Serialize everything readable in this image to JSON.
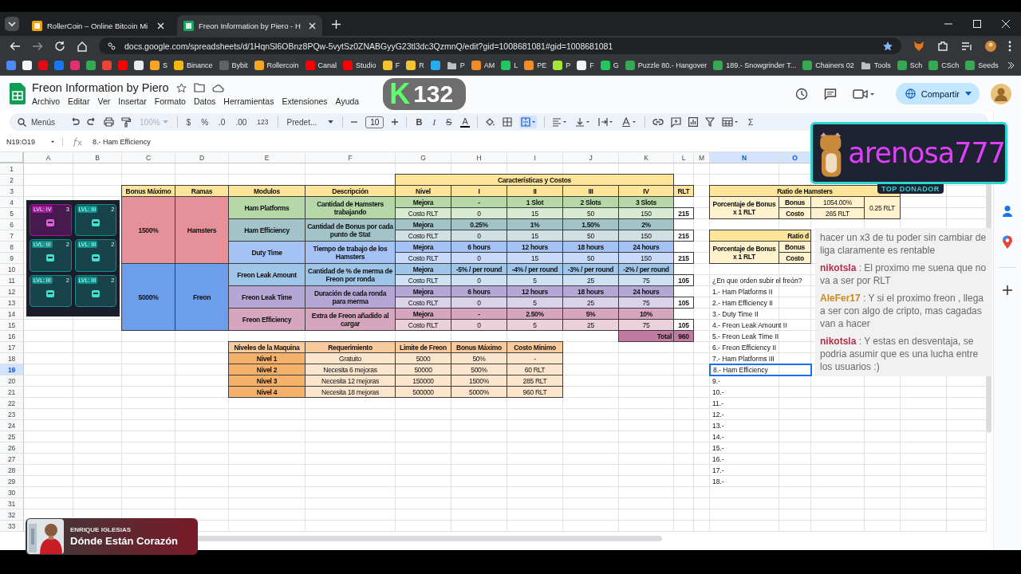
{
  "browser": {
    "tabs": [
      {
        "title": "RollerCoin – Online Bitcoin Mi",
        "selected": false
      },
      {
        "title": "Freon Information by Piero - H",
        "selected": true
      }
    ],
    "url": "docs.google.com/spreadsheets/d/1HqnSl6OBnz8PQw-5vytSz0ZNABGyyG23tl3dc3QzmnQ/edit?gid=1008681081#gid=1008681081",
    "bookmarks": [
      {
        "kind": "site",
        "color": "#4c8bf5"
      },
      {
        "kind": "site",
        "color": "#f1f3f4"
      },
      {
        "kind": "site",
        "color": "#e50914"
      },
      {
        "kind": "site",
        "color": "#1877f2"
      },
      {
        "kind": "site",
        "color": "#e1306c"
      },
      {
        "kind": "site",
        "color": "#34a853"
      },
      {
        "kind": "site",
        "color": "#ea4335"
      },
      {
        "kind": "site",
        "color": "#ff0000"
      },
      {
        "kind": "site",
        "color": "#e8eaed"
      },
      {
        "kind": "site",
        "color": "#f5a623",
        "label": "S"
      },
      {
        "kind": "site",
        "color": "#f0b90b",
        "label": "Binance"
      },
      {
        "kind": "site",
        "color": "#5f6368",
        "label": "Bybit"
      },
      {
        "kind": "site",
        "color": "#f5a623",
        "label": "Rollercoin"
      },
      {
        "kind": "site",
        "color": "#ff0000",
        "label": "Canal"
      },
      {
        "kind": "site",
        "color": "#ff0000",
        "label": "Studio"
      },
      {
        "kind": "site",
        "color": "#f4c430",
        "label": "F"
      },
      {
        "kind": "site",
        "color": "#f4c430",
        "label": "R"
      },
      {
        "kind": "site",
        "color": "#2aabee"
      },
      {
        "kind": "folder",
        "color": "#bdc1c6",
        "label": "P"
      },
      {
        "kind": "site",
        "color": "#f28c28",
        "label": "AM"
      },
      {
        "kind": "site",
        "color": "#22c55e",
        "label": "L"
      },
      {
        "kind": "site",
        "color": "#f28c28",
        "label": "PE"
      },
      {
        "kind": "site",
        "color": "#a3e635",
        "label": "P"
      },
      {
        "kind": "site",
        "color": "#f1f3f4",
        "label": "F"
      },
      {
        "kind": "site",
        "color": "#22c55e",
        "label": "G"
      },
      {
        "kind": "site",
        "color": "#34a853",
        "label": "Puzzle 80.- Hangover"
      },
      {
        "kind": "site",
        "color": "#34a853",
        "label": "189.- Snowgrinder T..."
      },
      {
        "kind": "site",
        "color": "#34a853",
        "label": "Chainers 02"
      },
      {
        "kind": "folder",
        "color": "#bdc1c6",
        "label": "Tools"
      },
      {
        "kind": "site",
        "color": "#34a853",
        "label": "Sch"
      },
      {
        "kind": "site",
        "color": "#34a853",
        "label": "CSch"
      },
      {
        "kind": "site",
        "color": "#34a853",
        "label": "Seeds"
      }
    ]
  },
  "document": {
    "title": "Freon Information by Piero",
    "menu": [
      "Archivo",
      "Editar",
      "Ver",
      "Insertar",
      "Formato",
      "Datos",
      "Herramientas",
      "Extensiones",
      "Ayuda"
    ],
    "share_button": "Compartir"
  },
  "toolbar": {
    "search": "Menús",
    "zoom": {
      "label": "100%",
      "disabled": true
    },
    "currency": "$",
    "percent": "%",
    "decrease_decimals": ".0",
    "increase_decimals": ".00",
    "number_format": "123",
    "font": "Predet...",
    "font_size": "10",
    "bold": "B",
    "italic": "I",
    "strikethrough": "S",
    "text_color": "A",
    "sum": "Σ"
  },
  "formula_bar": {
    "cell": "N19:O19",
    "value": "8.- Ham Efficiency"
  },
  "sheet": {
    "columns": [
      {
        "label": "A",
        "selected": false
      },
      {
        "label": "B",
        "selected": false
      },
      {
        "label": "C",
        "selected": false
      },
      {
        "label": "D",
        "selected": false
      },
      {
        "label": "E",
        "selected": false
      },
      {
        "label": "F",
        "selected": false
      },
      {
        "label": "G",
        "selected": false
      },
      {
        "label": "H",
        "selected": false
      },
      {
        "label": "I",
        "selected": false
      },
      {
        "label": "J",
        "selected": false
      },
      {
        "label": "K",
        "selected": false
      },
      {
        "label": "L",
        "selected": false
      },
      {
        "label": "M",
        "selected": false
      },
      {
        "label": "N",
        "selected": true
      },
      {
        "label": "O",
        "selected": true
      }
    ],
    "rows": [
      {
        "label": "1",
        "selected": false
      },
      {
        "label": "2",
        "selected": false
      },
      {
        "label": "3",
        "selected": false
      },
      {
        "label": "4",
        "selected": false
      },
      {
        "label": "5",
        "selected": false
      },
      {
        "label": "6",
        "selected": false
      },
      {
        "label": "7",
        "selected": false
      },
      {
        "label": "8",
        "selected": false
      },
      {
        "label": "9",
        "selected": false
      },
      {
        "label": "10",
        "selected": false
      },
      {
        "label": "11",
        "selected": false
      },
      {
        "label": "12",
        "selected": false
      },
      {
        "label": "13",
        "selected": false
      },
      {
        "label": "14",
        "selected": false
      },
      {
        "label": "15",
        "selected": false
      },
      {
        "label": "16",
        "selected": false
      },
      {
        "label": "17",
        "selected": false
      },
      {
        "label": "18",
        "selected": false
      },
      {
        "label": "19",
        "selected": true
      },
      {
        "label": "20",
        "selected": false
      },
      {
        "label": "21",
        "selected": false
      },
      {
        "label": "22",
        "selected": false
      },
      {
        "label": "23",
        "selected": false
      },
      {
        "label": "24",
        "selected": false
      },
      {
        "label": "25",
        "selected": false
      },
      {
        "label": "26",
        "selected": false
      },
      {
        "label": "27",
        "selected": false
      },
      {
        "label": "28",
        "selected": false
      },
      {
        "label": "29",
        "selected": false
      },
      {
        "label": "30",
        "selected": false
      },
      {
        "label": "31",
        "selected": false
      },
      {
        "label": "32",
        "selected": false
      },
      {
        "label": "33",
        "selected": false
      }
    ],
    "game_tiles": [
      {
        "level": "LVL: IV",
        "count": "3",
        "color": "#a0169a"
      },
      {
        "level": "LVL: III",
        "count": "2",
        "color": "#0e8f8a"
      },
      {
        "level": "LVL: III",
        "count": "2",
        "color": "#0e8f8a"
      },
      {
        "level": "LVL: III",
        "count": "2",
        "color": "#0e8f8a"
      },
      {
        "level": "LVL: III",
        "count": "2",
        "color": "#0e8f8a"
      },
      {
        "level": "LVL: III",
        "count": "2",
        "color": "#0e8f8a"
      }
    ],
    "cells": [
      {
        "text": "Características y Costos",
        "color": "#ffe599",
        "bold": true
      },
      {
        "text": "Bonus Máximo",
        "color": "#ffe599",
        "bold": true
      },
      {
        "text": "Ramas",
        "color": "#ffe599",
        "bold": true
      },
      {
        "text": "Modulos",
        "color": "#ffe599",
        "bold": true
      },
      {
        "text": "Descripción",
        "color": "#ffe599",
        "bold": true
      },
      {
        "text": "Nivel",
        "color": "#ffe599",
        "bold": true
      },
      {
        "text": "I",
        "color": "#ffe599",
        "bold": true
      },
      {
        "text": "II",
        "color": "#ffe599",
        "bold": true
      },
      {
        "text": "III",
        "color": "#ffe599",
        "bold": true
      },
      {
        "text": "IV",
        "color": "#ffe599",
        "bold": true
      },
      {
        "text": "RLT",
        "color": "#ffe599",
        "bold": true
      },
      {
        "text": "1500%",
        "color": "#e6919a",
        "bold": true
      },
      {
        "text": "Hamsters",
        "color": "#e6919a",
        "bold": true
      },
      {
        "text": "5000%",
        "color": "#6d9eeb",
        "bold": true
      },
      {
        "text": "Freon",
        "color": "#6d9eeb",
        "bold": true
      },
      {
        "text": "Ham Platforms",
        "color": "#b6d7a8",
        "bold": true
      },
      {
        "text": "Cantidad de Hamsters trabajando",
        "color": "#b6d7a8",
        "bold": true
      },
      {
        "text": "Mejora",
        "color": "#b6d7a8",
        "bold": true
      },
      {
        "text": "-",
        "color": "#b6d7a8",
        "bold": true
      },
      {
        "text": "1 Slot",
        "color": "#b6d7a8",
        "bold": true
      },
      {
        "text": "2 Slots",
        "color": "#b6d7a8",
        "bold": true
      },
      {
        "text": "3 Slots",
        "color": "#b6d7a8",
        "bold": true
      },
      {
        "text": "Costo RLT",
        "color": "#d9ead3",
        "bold": false
      },
      {
        "text": "0",
        "color": "#d9ead3",
        "bold": false
      },
      {
        "text": "15",
        "color": "#d9ead3",
        "bold": false
      },
      {
        "text": "50",
        "color": "#d9ead3",
        "bold": false
      },
      {
        "text": "150",
        "color": "#d9ead3",
        "bold": false
      },
      {
        "text": "215",
        "color": "#ffffff",
        "bold": true
      },
      {
        "text": "Ham Efficiency",
        "color": "#a2c4c9",
        "bold": true
      },
      {
        "text": "Cantidad de Bonus por cada punto de Stat",
        "color": "#a2c4c9",
        "bold": true
      },
      {
        "text": "Mejora",
        "color": "#a2c4c9",
        "bold": true
      },
      {
        "text": "0.25%",
        "color": "#a2c4c9",
        "bold": true
      },
      {
        "text": "1%",
        "color": "#a2c4c9",
        "bold": true
      },
      {
        "text": "1.50%",
        "color": "#a2c4c9",
        "bold": true
      },
      {
        "text": "2%",
        "color": "#a2c4c9",
        "bold": true
      },
      {
        "text": "Costo RLT",
        "color": "#d0e0e3",
        "bold": false
      },
      {
        "text": "0",
        "color": "#d0e0e3",
        "bold": false
      },
      {
        "text": "15",
        "color": "#d0e0e3",
        "bold": false
      },
      {
        "text": "50",
        "color": "#d0e0e3",
        "bold": false
      },
      {
        "text": "150",
        "color": "#d0e0e3",
        "bold": false
      },
      {
        "text": "215",
        "color": "#ffffff",
        "bold": true
      },
      {
        "text": "Duty Time",
        "color": "#a4c2f4",
        "bold": true
      },
      {
        "text": "Tiempo de trabajo de los Hamsters",
        "color": "#a4c2f4",
        "bold": true
      },
      {
        "text": "Mejora",
        "color": "#a4c2f4",
        "bold": true
      },
      {
        "text": "6 hours",
        "color": "#a4c2f4",
        "bold": true
      },
      {
        "text": "12 hours",
        "color": "#a4c2f4",
        "bold": true
      },
      {
        "text": "18 hours",
        "color": "#a4c2f4",
        "bold": true
      },
      {
        "text": "24 hours",
        "color": "#a4c2f4",
        "bold": true
      },
      {
        "text": "Costo RLT",
        "color": "#c9daf8",
        "bold": false
      },
      {
        "text": "0",
        "color": "#c9daf8",
        "bold": false
      },
      {
        "text": "15",
        "color": "#c9daf8",
        "bold": false
      },
      {
        "text": "50",
        "color": "#c9daf8",
        "bold": false
      },
      {
        "text": "150",
        "color": "#c9daf8",
        "bold": false
      },
      {
        "text": "215",
        "color": "#ffffff",
        "bold": true
      },
      {
        "text": "Freon Leak Amount",
        "color": "#9fc5e8",
        "bold": true
      },
      {
        "text": "Cantidad de % de merma de Freon por ronda",
        "color": "#9fc5e8",
        "bold": true
      },
      {
        "text": "Mejora",
        "color": "#9fc5e8",
        "bold": true
      },
      {
        "text": "-5% / per round",
        "color": "#9fc5e8",
        "bold": true
      },
      {
        "text": "-4% / per round",
        "color": "#9fc5e8",
        "bold": true
      },
      {
        "text": "-3% / per round",
        "color": "#9fc5e8",
        "bold": true
      },
      {
        "text": "-2% / per round",
        "color": "#9fc5e8",
        "bold": true
      },
      {
        "text": "Costo RLT",
        "color": "#cfe2f3",
        "bold": false
      },
      {
        "text": "0",
        "color": "#cfe2f3",
        "bold": false
      },
      {
        "text": "5",
        "color": "#cfe2f3",
        "bold": false
      },
      {
        "text": "25",
        "color": "#cfe2f3",
        "bold": false
      },
      {
        "text": "75",
        "color": "#cfe2f3",
        "bold": false
      },
      {
        "text": "105",
        "color": "#ffffff",
        "bold": true
      },
      {
        "text": "Freon Leak Time",
        "color": "#b4a7d6",
        "bold": true
      },
      {
        "text": "Duración de cada ronda para merma",
        "color": "#b4a7d6",
        "bold": true
      },
      {
        "text": "Mejora",
        "color": "#b4a7d6",
        "bold": true
      },
      {
        "text": "6 hours",
        "color": "#b4a7d6",
        "bold": true
      },
      {
        "text": "12 hours",
        "color": "#b4a7d6",
        "bold": true
      },
      {
        "text": "18 hours",
        "color": "#b4a7d6",
        "bold": true
      },
      {
        "text": "24 hours",
        "color": "#b4a7d6",
        "bold": true
      },
      {
        "text": "Costo RLT",
        "color": "#d9d2e9",
        "bold": false
      },
      {
        "text": "0",
        "color": "#d9d2e9",
        "bold": false
      },
      {
        "text": "5",
        "color": "#d9d2e9",
        "bold": false
      },
      {
        "text": "25",
        "color": "#d9d2e9",
        "bold": false
      },
      {
        "text": "75",
        "color": "#d9d2e9",
        "bold": false
      },
      {
        "text": "105",
        "color": "#ffffff",
        "bold": true
      },
      {
        "text": "Freon Efficiency",
        "color": "#d5a6bd",
        "bold": true
      },
      {
        "text": "Extra de Freon añadido al cargar",
        "color": "#d5a6bd",
        "bold": true
      },
      {
        "text": "Mejora",
        "color": "#d5a6bd",
        "bold": true
      },
      {
        "text": "-",
        "color": "#d5a6bd",
        "bold": true
      },
      {
        "text": "2.50%",
        "color": "#d5a6bd",
        "bold": true
      },
      {
        "text": "5%",
        "color": "#d5a6bd",
        "bold": true
      },
      {
        "text": "10%",
        "color": "#d5a6bd",
        "bold": true
      },
      {
        "text": "Costo RLT",
        "color": "#ead1dc",
        "bold": false
      },
      {
        "text": "0",
        "color": "#ead1dc",
        "bold": false
      },
      {
        "text": "5",
        "color": "#ead1dc",
        "bold": false
      },
      {
        "text": "25",
        "color": "#ead1dc",
        "bold": false
      },
      {
        "text": "75",
        "color": "#ead1dc",
        "bold": false
      },
      {
        "text": "105",
        "color": "#ffffff",
        "bold": true
      },
      {
        "text": "Total",
        "color": "#c27ba0",
        "bold": true
      },
      {
        "text": "960",
        "color": "#c27ba0",
        "bold": true
      },
      {
        "text": "Niveles de la Maquina",
        "color": "#f9cb9c",
        "bold": true
      },
      {
        "text": "Requerimiento",
        "color": "#f9cb9c",
        "bold": true
      },
      {
        "text": "Limite de Freon",
        "color": "#f9cb9c",
        "bold": true
      },
      {
        "text": "Bonus Máximo",
        "color": "#f9cb9c",
        "bold": true
      },
      {
        "text": "Costo Minimo",
        "color": "#f9cb9c",
        "bold": true
      },
      {
        "text": "Nivel 1",
        "color": "#f6b26b",
        "bold": true
      },
      {
        "text": "Gratuito",
        "color": "#fce5cd",
        "bold": false
      },
      {
        "text": "5000",
        "color": "#fce5cd",
        "bold": false
      },
      {
        "text": "50%",
        "color": "#fce5cd",
        "bold": false
      },
      {
        "text": "-",
        "color": "#fce5cd",
        "bold": false
      },
      {
        "text": "Nivel 2",
        "color": "#f6b26b",
        "bold": true
      },
      {
        "text": "Necesita 6 mejoras",
        "color": "#fce5cd",
        "bold": false
      },
      {
        "text": "50000",
        "color": "#fce5cd",
        "bold": false
      },
      {
        "text": "500%",
        "color": "#fce5cd",
        "bold": false
      },
      {
        "text": "60 RLT",
        "color": "#fce5cd",
        "bold": false
      },
      {
        "text": "Nivel 3",
        "color": "#f6b26b",
        "bold": true
      },
      {
        "text": "Necesita 12 mejoras",
        "color": "#fce5cd",
        "bold": false
      },
      {
        "text": "150000",
        "color": "#fce5cd",
        "bold": false
      },
      {
        "text": "1500%",
        "color": "#fce5cd",
        "bold": false
      },
      {
        "text": "285 RLT",
        "color": "#fce5cd",
        "bold": false
      },
      {
        "text": "Nivel 4",
        "color": "#f6b26b",
        "bold": true
      },
      {
        "text": "Necesita 18 mejoras",
        "color": "#fce5cd",
        "bold": false
      },
      {
        "text": "500000",
        "color": "#fce5cd",
        "bold": false
      },
      {
        "text": "5000%",
        "color": "#fce5cd",
        "bold": false
      },
      {
        "text": "960 RLT",
        "color": "#fce5cd",
        "bold": false
      },
      {
        "text": "Ratio de Hamsters",
        "color": "#ffe599",
        "bold": true
      },
      {
        "text": "Porcentaje de Bonus x 1 RLT",
        "color": "#fff2cc",
        "bold": true
      },
      {
        "text": "Bonus",
        "color": "#fff2cc",
        "bold": true
      },
      {
        "text": "Costo",
        "color": "#fff2cc",
        "bold": true
      },
      {
        "text": "1054.00%",
        "color": "#fff2cc",
        "bold": false
      },
      {
        "text": "265 RLT",
        "color": "#fff2cc",
        "bold": false
      },
      {
        "text": "0.25 RLT",
        "color": "#fff2cc",
        "bold": false
      },
      {
        "text": "Ratio d",
        "color": "#ffe599",
        "bold": true
      },
      {
        "text": "Porcentaje de Bonus x 1 RLT",
        "color": "#fff2cc",
        "bold": true
      },
      {
        "text": "Bonus",
        "color": "#fff2cc",
        "bold": true
      },
      {
        "text": "Costo",
        "color": "#fff2cc",
        "bold": true
      }
    ],
    "order_list": [
      {
        "text": "¿En que orden subir el freón?",
        "selected": false
      },
      {
        "text": "1.- Ham Platforms II",
        "selected": false
      },
      {
        "text": "2.- Ham Efficiency II",
        "selected": false
      },
      {
        "text": "3.- Duty Time II",
        "selected": false
      },
      {
        "text": "4.- Freon Leak Amount II",
        "selected": false
      },
      {
        "text": "5.- Freon Leak Time II",
        "selected": false
      },
      {
        "text": "6.- Freon Efficiency II",
        "selected": false
      },
      {
        "text": "7.- Ham Platforms III",
        "selected": false
      },
      {
        "text": "8.- Ham Efficiency",
        "selected": true
      },
      {
        "text": "9.-",
        "selected": false
      },
      {
        "text": "10.-",
        "selected": false
      },
      {
        "text": "11.-",
        "selected": false
      },
      {
        "text": "12.-",
        "selected": false
      },
      {
        "text": "13.-",
        "selected": false
      },
      {
        "text": "14.-",
        "selected": false
      },
      {
        "text": "15.-",
        "selected": false
      },
      {
        "text": "16.-",
        "selected": false
      },
      {
        "text": "17.-",
        "selected": false
      },
      {
        "text": "18.-",
        "selected": false
      }
    ]
  },
  "overlays": {
    "counter": {
      "logo": "K",
      "value": "132"
    },
    "donor": {
      "name": "arenosa777",
      "badge": "TOP DONADOR"
    },
    "chat": [
      {
        "text": "hacer un x3 de tu poder sin cambiar de liga claramente es rentable"
      },
      {
        "user": "nikotsla",
        "color": "#b0304a",
        "text": ": El proximo me suena que no va a ser por RLT"
      },
      {
        "user": "AleFer17",
        "color": "#c98a1e",
        "text": ": Y si el proximo freon , llega a ser con algo de cripto, mas cagadas van a hacer"
      },
      {
        "user": "nikotsla",
        "color": "#b0304a",
        "text": ": Y estas en desventaja, se podria asumir que es una lucha entre los usuarios :)"
      }
    ],
    "now_playing": {
      "artist": "ENRIQUE IGLESIAS",
      "song": "Dónde Están Corazón"
    }
  }
}
